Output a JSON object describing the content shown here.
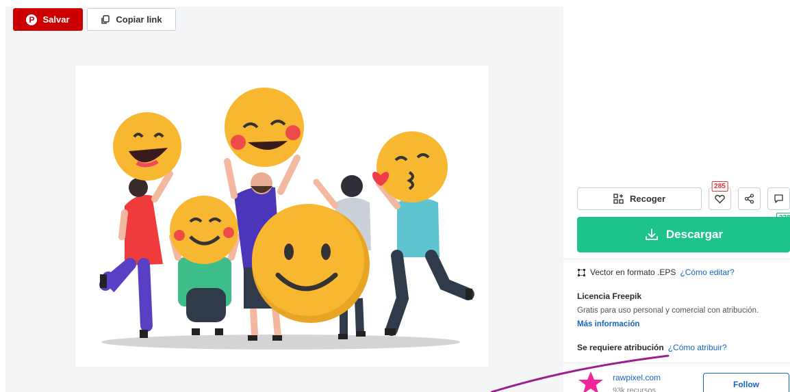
{
  "toolbar": {
    "save_label": "Salvar",
    "copy_label": "Copiar link"
  },
  "side": {
    "collect_label": "Recoger",
    "likes_count": "285",
    "comments_count": "228",
    "download_label": "Descargar",
    "format_text": "Vector en formato .EPS",
    "edit_link": "¿Cómo editar?",
    "license_title": "Licencia Freepik",
    "license_desc": "Gratis para uso personal y comercial con atribución.",
    "more_info": "Más información",
    "attribution_text": "Se requiere atribución",
    "attribution_link": "¿Cómo atribuir?",
    "author_name": "rawpixel.com",
    "author_sub": "93k recursos",
    "follow_label": "Follow"
  },
  "colors": {
    "pinterest_red": "#cc0000",
    "download_green": "#1cc48a",
    "link_blue": "#1565c0",
    "emoji_yellow": "#f7b731",
    "scribble_purple": "#9c1f8f"
  },
  "icons": [
    "pinterest-icon",
    "copy-icon",
    "collect-icon",
    "heart-icon",
    "share-icon",
    "comment-icon",
    "download-icon",
    "vector-format-icon",
    "star-avatar-icon"
  ]
}
